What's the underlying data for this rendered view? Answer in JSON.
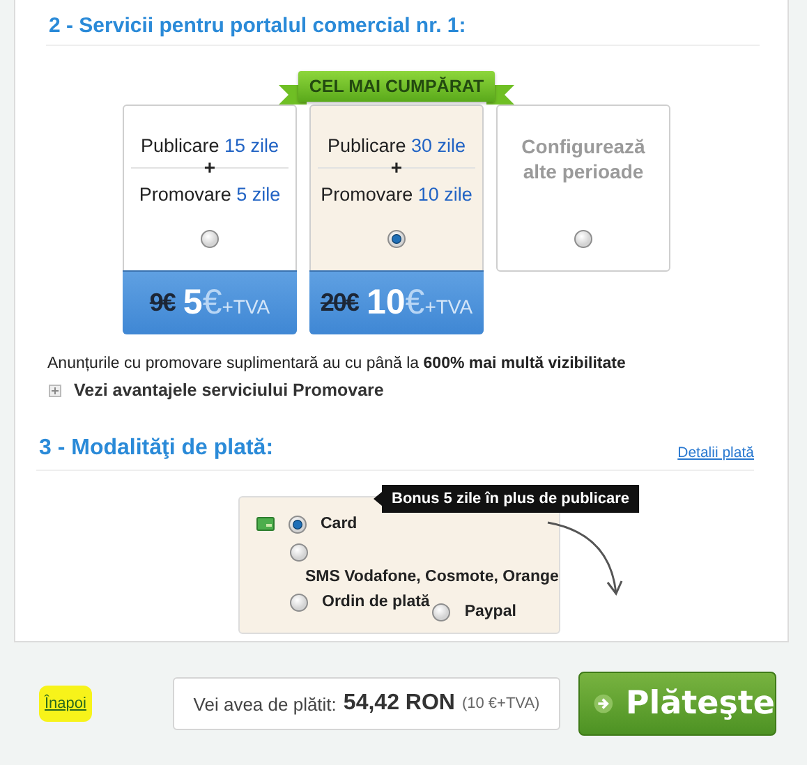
{
  "section_2": {
    "title": "2 - Servicii pentru portalul comercial nr. 1:",
    "plans": [
      {
        "kind": "bundle",
        "selected": false,
        "publish_label": "Publicare",
        "publish_days": "15 zile",
        "plus": "+",
        "promote_label": "Promovare",
        "promote_days": "5 zile",
        "old_price": "9€",
        "price": "5",
        "currency": "€",
        "tax": "+TVA"
      },
      {
        "kind": "bundle",
        "selected": true,
        "badge": "CEL MAI CUMPĂRAT",
        "publish_label": "Publicare",
        "publish_days": "30 zile",
        "plus": "+",
        "promote_label": "Promovare",
        "promote_days": "10 zile",
        "old_price": "20€",
        "price": "10",
        "currency": "€",
        "tax": "+TVA"
      },
      {
        "kind": "custom",
        "selected": false,
        "label": "Configurează alte perioade"
      }
    ],
    "note": "Anunțurile cu promovare suplimentară au cu până la **600% mai multă vizibilitate**",
    "expand": {
      "label": "Vezi avantajele serviciului Promovare",
      "expanded": false
    }
  },
  "section_3": {
    "title": "3 - Modalităţi de plată:",
    "details_link": "Detalii plată",
    "methods": [
      {
        "kind": "card",
        "label": "Card",
        "selected": true
      },
      {
        "kind": "wrapped",
        "label": "SMS Vodafone, Cosmote, Orange",
        "selected": false
      },
      {
        "kind": "plain",
        "label": "Ordin de plată",
        "selected": false
      },
      {
        "kind": "inline",
        "label": "Paypal",
        "selected": false
      }
    ],
    "tooltip": "Bonus 5 zile în plus de publicare"
  },
  "footer": {
    "back_link": "Înapoi",
    "back_highlighted": true,
    "total_label": "Vei avea de plătit:",
    "total": "54,42 RON",
    "total_note": "(10 €+TVA)",
    "pay_button": "Plăteşte"
  }
}
